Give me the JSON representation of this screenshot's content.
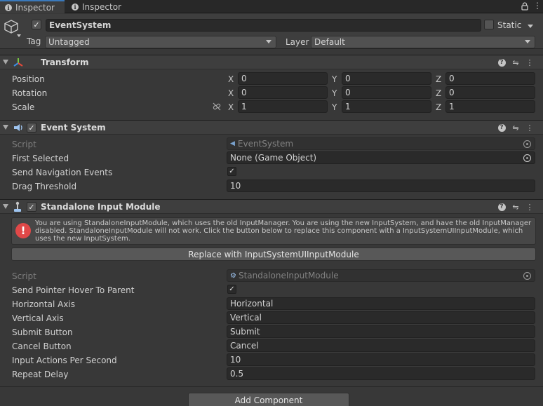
{
  "tabs": [
    {
      "label": "Inspector",
      "active": true
    },
    {
      "label": "Inspector",
      "active": false
    }
  ],
  "tab_bar_icons": [
    "lock-icon",
    "menu-icon"
  ],
  "gameobject": {
    "name": "EventSystem",
    "active": true,
    "static_label": "Static",
    "static": false,
    "tag_label": "Tag",
    "tag_value": "Untagged",
    "layer_label": "Layer",
    "layer_value": "Default"
  },
  "transform": {
    "title": "Transform",
    "position_label": "Position",
    "rotation_label": "Rotation",
    "scale_label": "Scale",
    "axes": [
      "X",
      "Y",
      "Z"
    ],
    "position": [
      "0",
      "0",
      "0"
    ],
    "rotation": [
      "0",
      "0",
      "0"
    ],
    "scale": [
      "1",
      "1",
      "1"
    ]
  },
  "event_system": {
    "title": "Event System",
    "enabled": true,
    "script_label": "Script",
    "script_value": "EventSystem",
    "first_selected_label": "First Selected",
    "first_selected_value": "None (Game Object)",
    "send_nav_label": "Send Navigation Events",
    "send_nav_value": true,
    "drag_threshold_label": "Drag Threshold",
    "drag_threshold_value": "10"
  },
  "standalone": {
    "title": "Standalone Input Module",
    "enabled": true,
    "warning": "You are using StandaloneInputModule, which uses the old InputManager. You are using the new InputSystem, and have the old InputManager disabled. StandaloneInputModule will not work. Click the button below to replace this component with a InputSystemUIInputModule, which uses the new InputSystem.",
    "replace_button": "Replace with InputSystemUIInputModule",
    "script_label": "Script",
    "script_value": "StandaloneInputModule",
    "send_hover_label": "Send Pointer Hover To Parent",
    "send_hover_value": true,
    "horizontal_axis_label": "Horizontal Axis",
    "horizontal_axis_value": "Horizontal",
    "vertical_axis_label": "Vertical Axis",
    "vertical_axis_value": "Vertical",
    "submit_label": "Submit Button",
    "submit_value": "Submit",
    "cancel_label": "Cancel Button",
    "cancel_value": "Cancel",
    "ips_label": "Input Actions Per Second",
    "ips_value": "10",
    "repeat_label": "Repeat Delay",
    "repeat_value": "0.5"
  },
  "add_component_button": "Add Component",
  "colors": {
    "background": "#383838",
    "field": "#2a2a2a",
    "tab_accent": "#3a79bb",
    "error": "#e04848"
  }
}
